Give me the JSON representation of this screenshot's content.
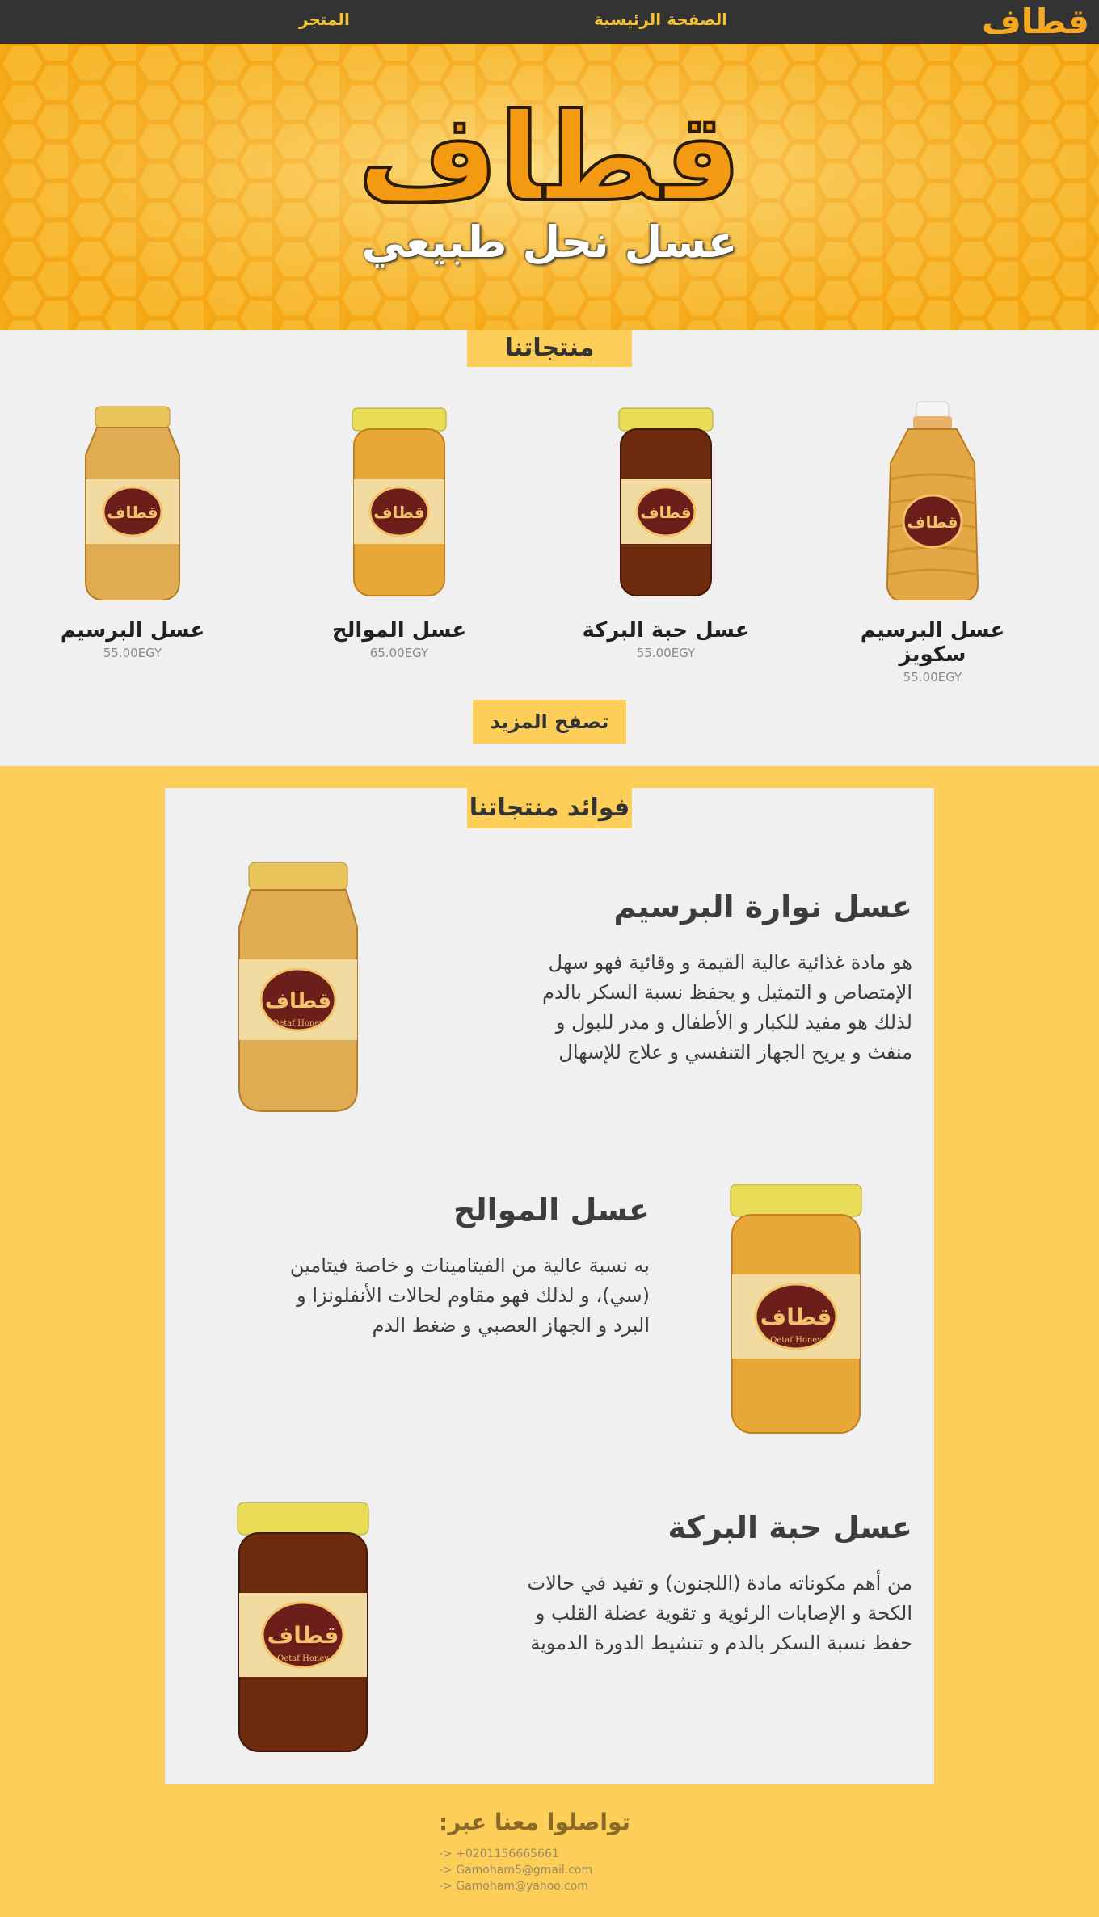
{
  "nav": {
    "logo": "قطاف",
    "home": "الصفحة الرئيسية",
    "store": "المتجر"
  },
  "hero": {
    "logo": "قطاف",
    "subtitle": "عسل نحل طبيعي"
  },
  "products": {
    "title": "منتجاتنا",
    "items": [
      {
        "name": "عسل البرسيم سكويز",
        "price": "55.00EGY",
        "type": "squeeze"
      },
      {
        "name": "عسل حبة البركة",
        "price": "55.00EGY",
        "type": "dark"
      },
      {
        "name": "عسل الموالح",
        "price": "65.00EGY",
        "type": "amber"
      },
      {
        "name": "عسل البرسيم",
        "price": "55.00EGY",
        "type": "creamy"
      }
    ],
    "more": "تصفح المزيد"
  },
  "benefits": {
    "title": "فوائد منتجاتنا",
    "items": [
      {
        "title": "عسل نوارة البرسيم",
        "lines": [
          "هو مادة غذائية عالية القيمة و وقائية فهو سهل",
          "الإمتصاص و التمثيل و يحفظ نسبة السكر بالدم",
          "لذلك هو مفيد للكبار و الأطفال و مدر للبول و",
          "منفث و يريح الجهاز التنفسي و علاج للإسهال"
        ]
      },
      {
        "title": "عسل الموالح",
        "lines": [
          "به نسبة عالية من الفيتامينات و خاصة فيتامين",
          "(سي)، و لذلك فهو مقاوم لحالات الأنفلونزا و",
          "البرد و الجهاز العصبي و ضغط الدم"
        ]
      },
      {
        "title": "عسل حبة البركة",
        "lines": [
          "من أهم مكوناته مادة (اللجنون) و تفيد في حالات",
          "الكحة و الإصابات الرئوية و تقوية عضلة القلب و",
          "حفظ نسبة السكر بالدم و تنشيط الدورة الدموية"
        ]
      }
    ]
  },
  "jar_label": {
    "brand": "قطاف",
    "english": "Qetaf Honey"
  },
  "footer": {
    "title": "تواصلوا معنا عبر:",
    "phone": "-> +0201156665661",
    "email1": "-> Gamoham5@gmail.com",
    "email2": "-> Gamoham@yahoo.com"
  },
  "colors": {
    "accent": "#fecf58",
    "nav_bg": "#333333",
    "panel_bg": "#f0f0f0",
    "logo_orange": "#f7a823"
  }
}
